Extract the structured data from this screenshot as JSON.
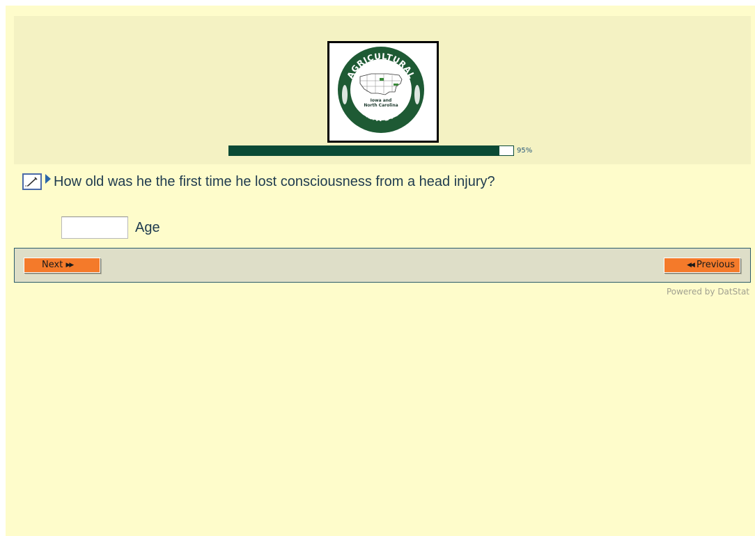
{
  "header": {
    "logo": {
      "text_top": "AGRICULTURAL",
      "text_bottom": "HEALTH STUDY",
      "text_center_1": "Iowa and",
      "text_center_2": "North Carolina"
    },
    "progress": {
      "value": 0.95,
      "label": "95%"
    }
  },
  "question": {
    "text": "How old was he the first time he lost consciousness from a head injury?",
    "edit_icon": "pencil-edit-icon",
    "pointer_icon": "triangle-right-icon"
  },
  "answer": {
    "value": "",
    "label": "Age"
  },
  "nav": {
    "next_label": "Next",
    "previous_label": "Previous"
  },
  "footer": {
    "powered_by": "Powered by DatStat"
  },
  "colors": {
    "page_bg": "#fefccb",
    "header_bg": "#f4f2c3",
    "progress_fill": "#0a4a35",
    "button_orange": "#f47a2a",
    "nav_bg": "#dedec8"
  }
}
